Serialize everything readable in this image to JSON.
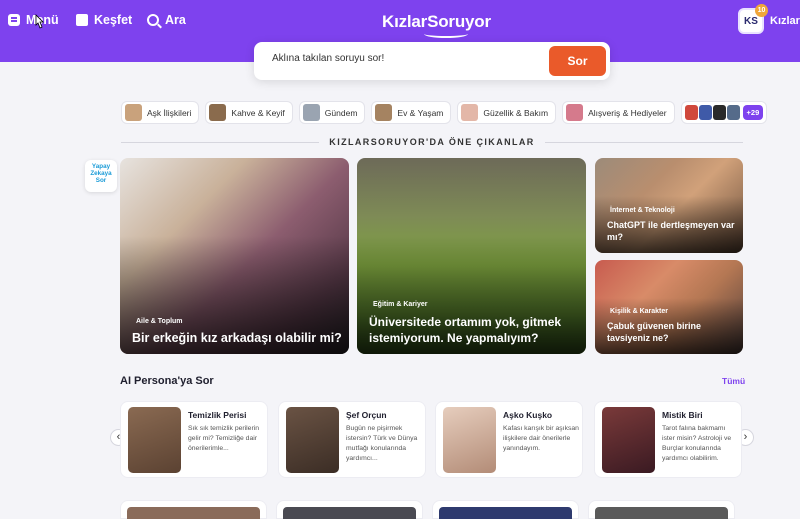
{
  "nav": {
    "menu_label": "Menü",
    "explore_label": "Keşfet",
    "search_label": "Ara"
  },
  "brand": {
    "logo_text": "KızlarSoruyor"
  },
  "account": {
    "avatar_initials": "KS",
    "badge_count": "10",
    "name": "Kızlar"
  },
  "search": {
    "placeholder": "Aklına takılan soruyu sor!",
    "button_label": "Sor"
  },
  "categories": [
    {
      "label": "Aşk İlişkileri",
      "color": "#c9a27c"
    },
    {
      "label": "Kahve & Keyif",
      "color": "#8a6b4d"
    },
    {
      "label": "Gündem",
      "color": "#9aa4b1"
    },
    {
      "label": "Ev & Yaşam",
      "color": "#a58361"
    },
    {
      "label": "Güzellik & Bakım",
      "color": "#e3b7a8"
    },
    {
      "label": "Alışveriş & Hediyeler",
      "color": "#d57a8c"
    }
  ],
  "categories_more": {
    "count_label": "+29"
  },
  "featured": {
    "section_title": "KIZLARSORUYOR'DA ÖNE ÇIKANLAR",
    "ai_fab_lines": [
      "Yapay",
      "Zekaya",
      "Sor"
    ],
    "cards": [
      {
        "tag": "Aile & Toplum",
        "title": "Bir erkeğin kız arkadaşı olabilir mi?"
      },
      {
        "tag": "Eğitim & Kariyer",
        "title": "Üniversitede ortamım yok, gitmek istemiyorum. Ne yapmalıyım?"
      },
      {
        "tag": "İnternet & Teknoloji",
        "title": "ChatGPT ile dertleşmeyen var mı?"
      },
      {
        "tag": "Kişilik & Karakter",
        "title": "Çabuk güvenen birine tavsiyeniz ne?"
      }
    ]
  },
  "personas": {
    "title": "AI Persona'ya Sor",
    "all_label": "Tümü",
    "items": [
      {
        "name": "Temizlik Perisi",
        "desc": "Sık sık temizlik perilerin gelir mi? Temizliğe dair önerilerimle...",
        "color": "#6b4f3c"
      },
      {
        "name": "Şef Orçun",
        "desc": "Bugün ne pişirmek istersin? Türk ve Dünya mutfağı konularında yardımcı...",
        "color": "#4c3b30"
      },
      {
        "name": "Aşko Kuşko",
        "desc": "Kafası karışık bir aşıksan ilişkilere dair önerilerle yanındayım.",
        "color": "#c7a893"
      },
      {
        "name": "Mistik Biri",
        "desc": "Tarot falına bakmamı ister misin? Astroloji ve Burçlar konularında yardımcı olabilirim.",
        "color": "#5a2a2e"
      }
    ]
  },
  "colors": {
    "brand": "#7e42ee",
    "accent": "#ea5a2a",
    "link": "#7e42ee"
  }
}
